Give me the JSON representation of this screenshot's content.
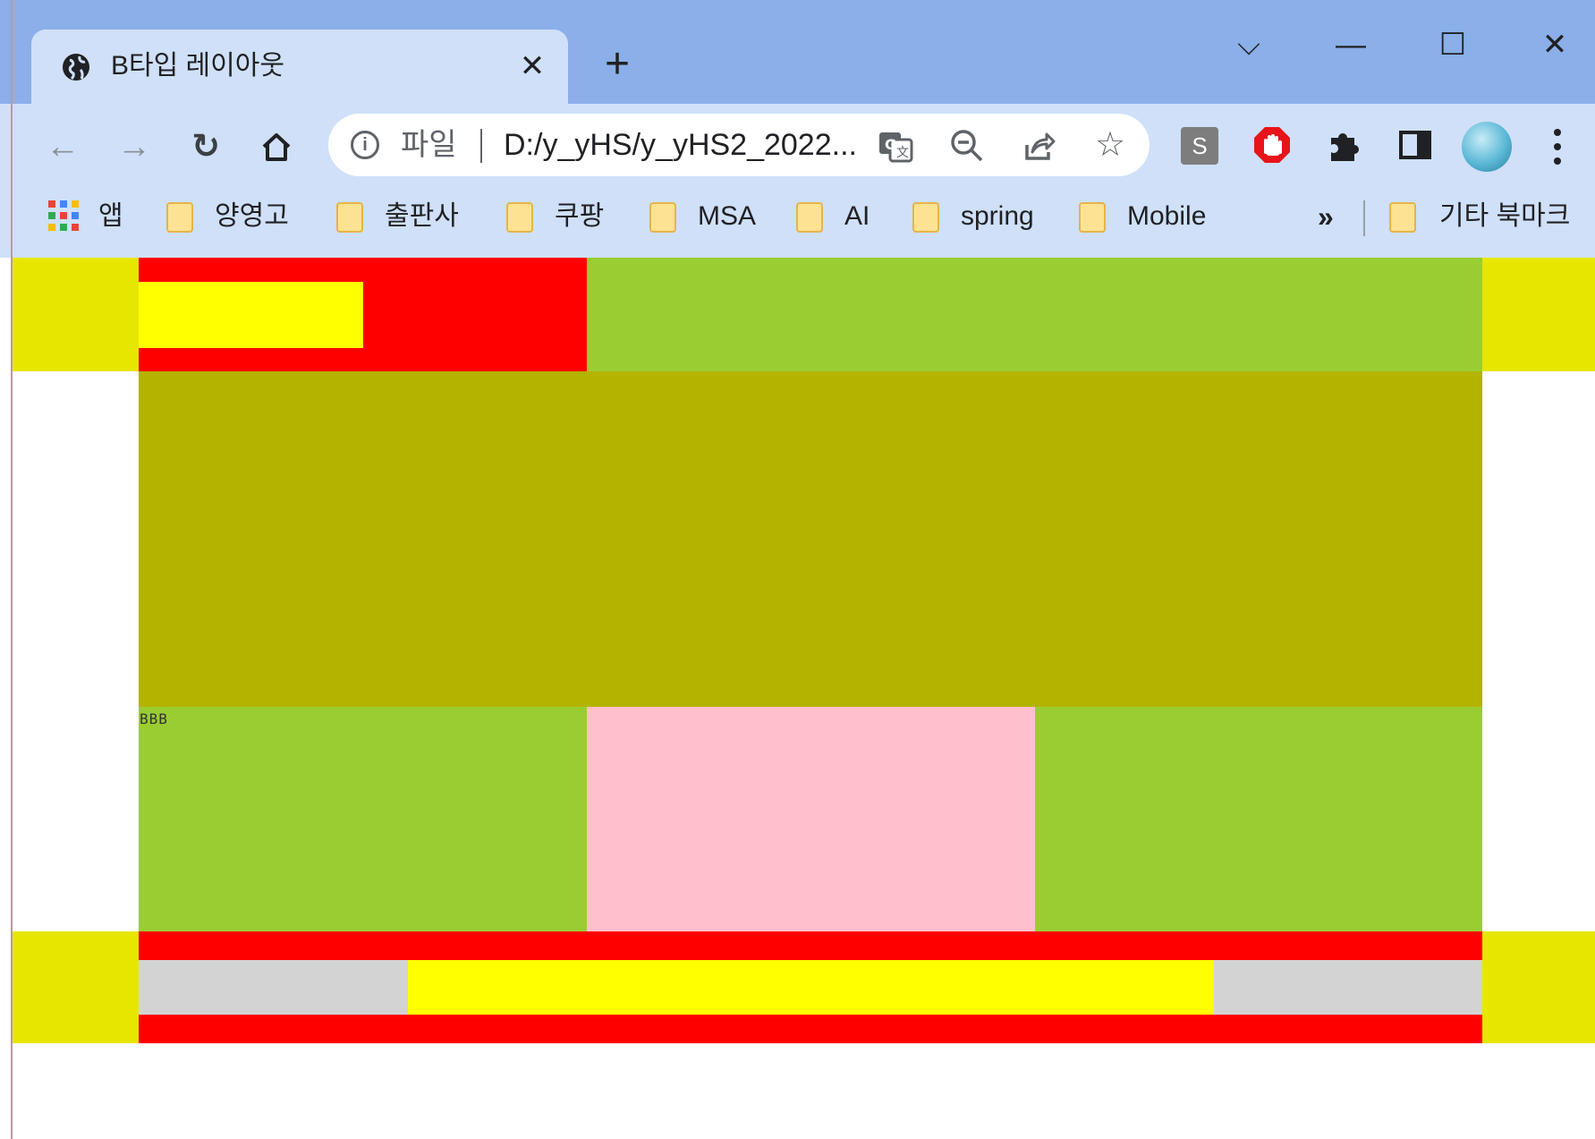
{
  "browser": {
    "tab_title": "B타입 레이아웃",
    "tab_close": "✕",
    "new_tab": "+",
    "window_buttons": {
      "tab_search": "⌵",
      "minimize": "—",
      "maximize": "☐",
      "close": "✕"
    },
    "address": {
      "scheme_label": "파일",
      "url": "D:/y_yHS/y_yHS2_2022..."
    },
    "extension_s_label": "S",
    "bookmarks": [
      {
        "label": "앱",
        "icon": "apps-grid-icon"
      },
      {
        "label": "양영고",
        "icon": "folder-icon"
      },
      {
        "label": "출판사",
        "icon": "folder-icon"
      },
      {
        "label": "쿠팡",
        "icon": "folder-icon"
      },
      {
        "label": "MSA",
        "icon": "folder-icon"
      },
      {
        "label": "AI",
        "icon": "folder-icon"
      },
      {
        "label": "spring",
        "icon": "folder-icon"
      },
      {
        "label": "Mobile",
        "icon": "folder-icon"
      }
    ],
    "overflow_chevron": "»",
    "other_bookmarks": "기타 북마크"
  },
  "page": {
    "content_label": "BBB",
    "colors": {
      "header_band": "#e6e600",
      "logo_box": "#ff0000",
      "logo_inner": "#ffff00",
      "nav": "#9acd32",
      "main_banner": "#b3b300",
      "column": "#9acd32",
      "column_center": "#ffc0cb",
      "footer_box": "#ff0000",
      "footer_strip": "#d3d3d3",
      "footer_inner": "#ffff00"
    }
  }
}
